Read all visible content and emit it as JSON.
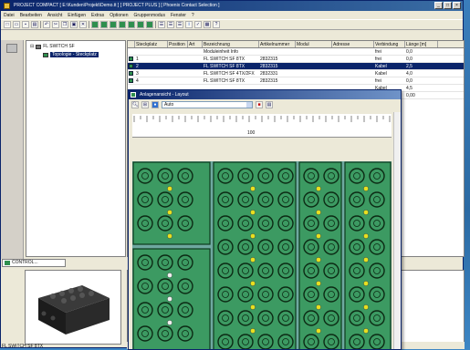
{
  "window": {
    "title": "PROJECT COMPACT [ E:\\Kunden\\Projekt\\Demo.tt ] [ PROJECT PLUS ] [ Phoenix Contact Selection ]",
    "controls": [
      "_",
      "□",
      "×"
    ]
  },
  "menu": [
    "Datei",
    "Bearbeiten",
    "Ansicht",
    "Einfügen",
    "Extras",
    "Optionen",
    "Gruppenmodus",
    "Fenster",
    "?"
  ],
  "toolbar_icons": [
    "new-icon",
    "open-icon",
    "save-icon",
    "print-icon",
    "undo-icon",
    "cut-icon",
    "copy-icon",
    "paste-icon",
    "delete-icon",
    "module-icon",
    "connector-icon",
    "cable-icon",
    "bus-icon",
    "info-icon",
    "check-icon",
    "help-icon"
  ],
  "tree": {
    "root": "FL SWITCH SF",
    "child": "Topologie - Steckplatz"
  },
  "left_tab": "CONTROL...",
  "table": {
    "columns": [
      "Nr",
      "Steckplatz",
      "Position",
      "Art",
      "Bezeichnung",
      "Artikelnummer",
      "Modul",
      "Adresse",
      "Verbindung",
      "Länge [m]"
    ],
    "rows": [
      {
        "nr": "",
        "slot": "",
        "pos": "",
        "type": "",
        "name": "Moduleinheit Info",
        "article": "",
        "module": "",
        "address": "",
        "conn": "frei",
        "len": "0,0"
      },
      {
        "nr": "",
        "slot": "1",
        "pos": "",
        "type": "",
        "name": "FL SWITCH SF 8TX",
        "article": "2832315",
        "module": "",
        "address": "",
        "conn": "frei",
        "len": "0,0"
      },
      {
        "nr": "",
        "slot": "2",
        "pos": "",
        "type": "",
        "name": "FL SWITCH SF 8TX",
        "article": "2832315",
        "module": "",
        "address": "",
        "conn": "Kabel",
        "len": "2,5",
        "selected": true
      },
      {
        "nr": "",
        "slot": "3",
        "pos": "",
        "type": "",
        "name": "FL SWITCH SF 4TX/2FX",
        "article": "2832331",
        "module": "",
        "address": "",
        "conn": "Kabel",
        "len": "4,0"
      },
      {
        "nr": "",
        "slot": "4",
        "pos": "",
        "type": "",
        "name": "FL SWITCH SF 8TX",
        "article": "2832315",
        "module": "",
        "address": "",
        "conn": "frei",
        "len": "0,0"
      },
      {
        "nr": "",
        "slot": "",
        "pos": "",
        "type": "",
        "name": "",
        "article": "",
        "module": "",
        "address": "",
        "conn": "Kabel",
        "len": "4,5"
      },
      {
        "nr": "",
        "slot": "",
        "pos": "",
        "type": "",
        "name": "",
        "article": "",
        "module": "",
        "address": "",
        "conn": "frei",
        "len": "0,00"
      }
    ]
  },
  "child_window": {
    "title": "Anlagenansicht - Layout",
    "zoom_value": "Auto",
    "ruler_label": "100"
  },
  "preview_caption": "FL SWITCH SF 8TX",
  "status": ""
}
